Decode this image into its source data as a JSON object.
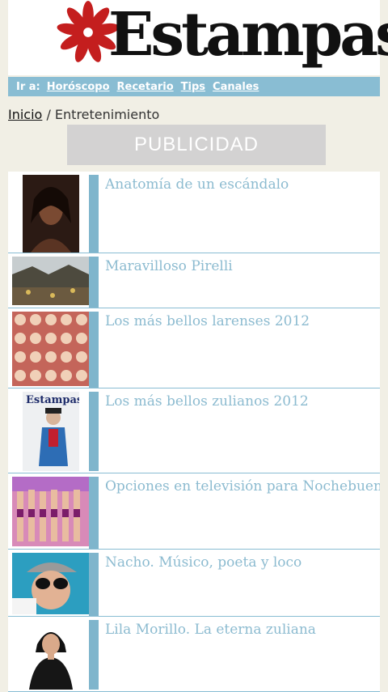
{
  "header": {
    "logo_text": "Estampas",
    "logo_flower_color": "#c41e1e"
  },
  "nav": {
    "label": "Ir a:",
    "links": [
      "Horóscopo",
      "Recetario",
      "Tips",
      "Canales"
    ]
  },
  "breadcrumb": {
    "home": "Inicio",
    "separator": "/",
    "current": "Entretenimiento"
  },
  "ad": {
    "label": "PUBLICIDAD"
  },
  "articles": [
    {
      "title": "Anatomía de un escándalo"
    },
    {
      "title": "Maravilloso Pirelli"
    },
    {
      "title": "Los más bellos larenses 2012"
    },
    {
      "title": "Los más bellos zulianos 2012"
    },
    {
      "title": "Opciones en televisión para Nochebuena"
    },
    {
      "title": "Nacho. Músico, poeta y loco"
    },
    {
      "title": "Lila Morillo. La eterna zuliana"
    }
  ],
  "colors": {
    "accent": "#89bdd3",
    "title_text": "#8cbbd0",
    "background": "#f1efe5"
  }
}
